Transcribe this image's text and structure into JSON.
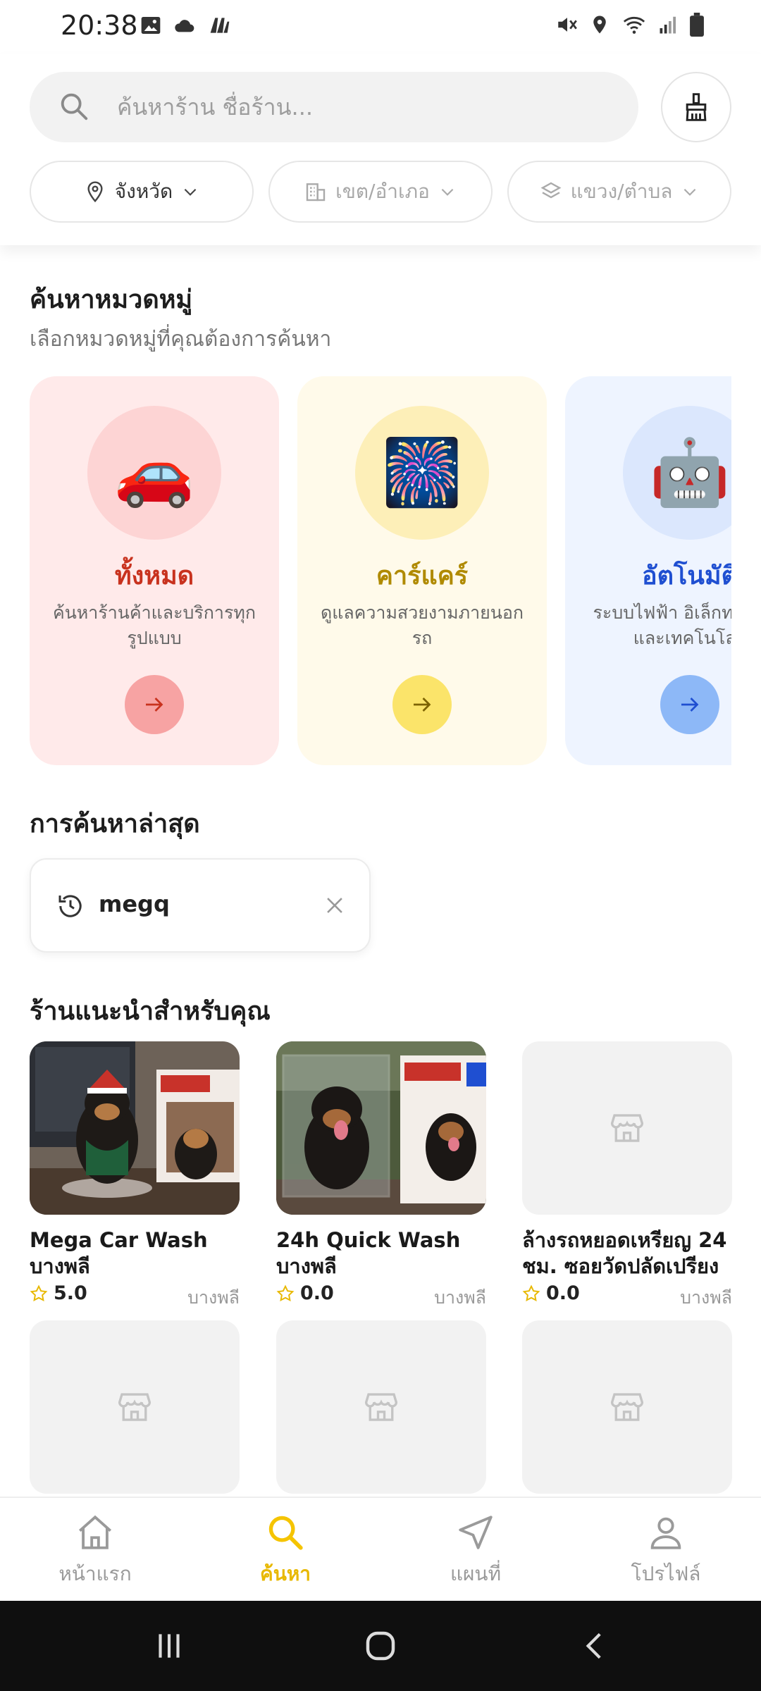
{
  "status_bar": {
    "time": "20:38",
    "left_icons": [
      "image-icon",
      "cloud-icon",
      "app-icon"
    ],
    "right_icons": [
      "mute-icon",
      "location-icon",
      "wifi-icon",
      "signal-icon",
      "battery-icon"
    ]
  },
  "search": {
    "placeholder": "ค้นหาร้าน ชื่อร้าน...",
    "value": ""
  },
  "filters": [
    {
      "label": "จังหวัด",
      "icon": "location-pin-icon",
      "enabled": true
    },
    {
      "label": "เขต/อำเภอ",
      "icon": "building-icon",
      "enabled": false
    },
    {
      "label": "แขวง/ตำบล",
      "icon": "layers-icon",
      "enabled": false
    }
  ],
  "categories_section": {
    "title": "ค้นหาหมวดหมู่",
    "subtitle": "เลือกหมวดหมู่ที่คุณต้องการค้นหา",
    "items": [
      {
        "title": "ทั้งหมด",
        "description": "ค้นหาร้านค้าและบริการทุกรูปแบบ",
        "emoji": "🚗",
        "colors": {
          "card": "#ffeaea",
          "circle": "#fdd4d4",
          "title": "#c8321e",
          "arrow_bg": "#f7a3a3",
          "arrow": "#c8321e"
        }
      },
      {
        "title": "คาร์แคร์",
        "description": "ดูแลความสวยงามภายนอกรถ",
        "emoji": "🎆",
        "colors": {
          "card": "#fffaea",
          "circle": "#fdefb8",
          "title": "#b08a00",
          "arrow_bg": "#fbe46a",
          "arrow": "#7d6300"
        }
      },
      {
        "title": "อัตโนมัติ",
        "description": "ระบบไฟฟ้า อิเล็กทรอนิกส์ และเทคโนโลยี",
        "emoji": "🤖",
        "colors": {
          "card": "#eef4ff",
          "circle": "#dbe7fd",
          "title": "#1f4fd1",
          "arrow_bg": "#8db8f7",
          "arrow": "#1f4fd1"
        }
      }
    ]
  },
  "recent_section": {
    "title": "การค้นหาล่าสุด",
    "items": [
      {
        "text": "megq"
      }
    ]
  },
  "shops_section": {
    "title": "ร้านแนะนำสำหรับคุณ",
    "shops": [
      {
        "name": "Mega Car Wash บางพลี",
        "rating": "5.0",
        "district": "บางพลี",
        "has_photo": true
      },
      {
        "name": "24h Quick Wash บางพลี",
        "rating": "0.0",
        "district": "บางพลี",
        "has_photo": true
      },
      {
        "name": "ล้างรถหยอดเหรียญ 24 ชม. ซอยวัดปลัดเปรียง",
        "rating": "0.0",
        "district": "บางพลี",
        "has_photo": false
      },
      {
        "name": "",
        "rating": "",
        "district": "",
        "has_photo": false
      },
      {
        "name": "",
        "rating": "",
        "district": "",
        "has_photo": false
      },
      {
        "name": "",
        "rating": "",
        "district": "",
        "has_photo": false
      }
    ]
  },
  "bottom_nav": {
    "items": [
      {
        "label": "หน้าแรก",
        "icon": "home-icon",
        "active": false
      },
      {
        "label": "ค้นหา",
        "icon": "search-icon",
        "active": true
      },
      {
        "label": "แผนที่",
        "icon": "navigation-icon",
        "active": false
      },
      {
        "label": "โปรไฟล์",
        "icon": "user-icon",
        "active": false
      }
    ]
  },
  "colors": {
    "accent": "#f5c400",
    "text_primary": "#1a1a1a",
    "text_secondary": "#777777"
  }
}
